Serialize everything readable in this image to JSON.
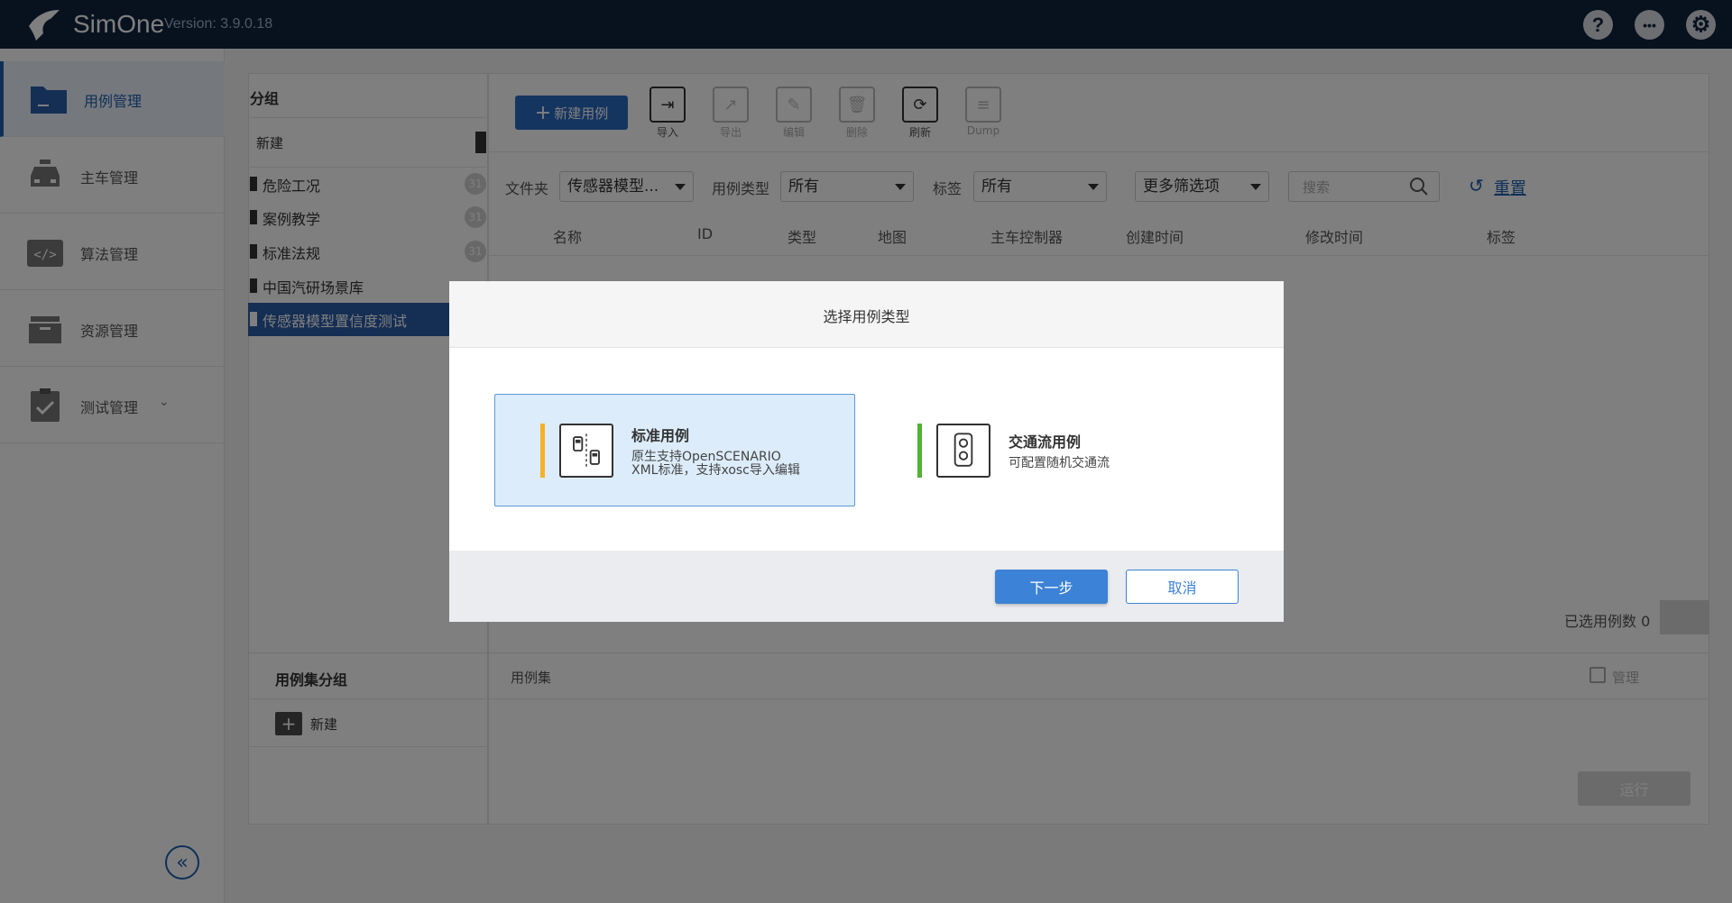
{
  "app": {
    "name": "SimOne",
    "version": "Version: 3.9.0.18"
  },
  "topbar": {
    "help": "?",
    "more": "•••",
    "settings": "⚙"
  },
  "sidebar": {
    "items": [
      {
        "label": "用例管理",
        "icon": "folder-icon",
        "active": true
      },
      {
        "label": "主车管理",
        "icon": "car-icon"
      },
      {
        "label": "算法管理",
        "icon": "code-icon"
      },
      {
        "label": "资源管理",
        "icon": "box-icon"
      },
      {
        "label": "测试管理",
        "icon": "clipboard-check-icon"
      }
    ],
    "collapse": "«"
  },
  "groups": {
    "title": "分组",
    "new_label": "新建",
    "items": [
      {
        "label": "危险工况",
        "count": "31"
      },
      {
        "label": "案例教学",
        "count": "31"
      },
      {
        "label": "标准法规",
        "count": "31"
      },
      {
        "label": "中国汽研场景库",
        "count": ""
      },
      {
        "label": "传感器模型置信度测试",
        "count": "",
        "active": true
      }
    ]
  },
  "suite_groups": {
    "title": "用例集分组",
    "new_label": "新建"
  },
  "toolbar": {
    "new_case": "新建用例",
    "tools": [
      {
        "label": "导入",
        "icon": "import-icon",
        "enabled": true
      },
      {
        "label": "导出",
        "icon": "export-icon",
        "enabled": false
      },
      {
        "label": "编辑",
        "icon": "edit-icon",
        "enabled": false
      },
      {
        "label": "删除",
        "icon": "trash-icon",
        "enabled": false
      },
      {
        "label": "刷新",
        "icon": "refresh-icon",
        "enabled": true
      },
      {
        "label": "Dump",
        "icon": "database-icon",
        "enabled": false
      }
    ]
  },
  "filters": {
    "folder_label": "文件夹",
    "folder_value": "传感器模型...",
    "type_label": "用例类型",
    "type_value": "所有",
    "tag_label": "标签",
    "tag_value": "所有",
    "more_value": "更多筛选项",
    "search_placeholder": "搜索",
    "reset": "重置"
  },
  "table": {
    "columns": [
      "名称",
      "ID",
      "类型",
      "地图",
      "主车控制器",
      "创建时间",
      "修改时间",
      "标签"
    ]
  },
  "footer": {
    "selected_count": "已选用例数 0",
    "suite_col": "用例集",
    "manage": "管理",
    "run": "运行"
  },
  "modal": {
    "title": "选择用例类型",
    "standard": {
      "title": "标准用例",
      "desc_line1": "原生支持OpenSCENARIO",
      "desc_line2": "XML标准，支持xosc导入编辑"
    },
    "traffic": {
      "title": "交通流用例",
      "desc": "可配置随机交通流"
    },
    "next": "下一步",
    "cancel": "取消"
  },
  "colors": {
    "topbar": "#10253f",
    "primary": "#2b6bc2",
    "active_group": "#2b5ca8",
    "standard_accent": "#f5b126",
    "traffic_accent": "#52b233"
  }
}
